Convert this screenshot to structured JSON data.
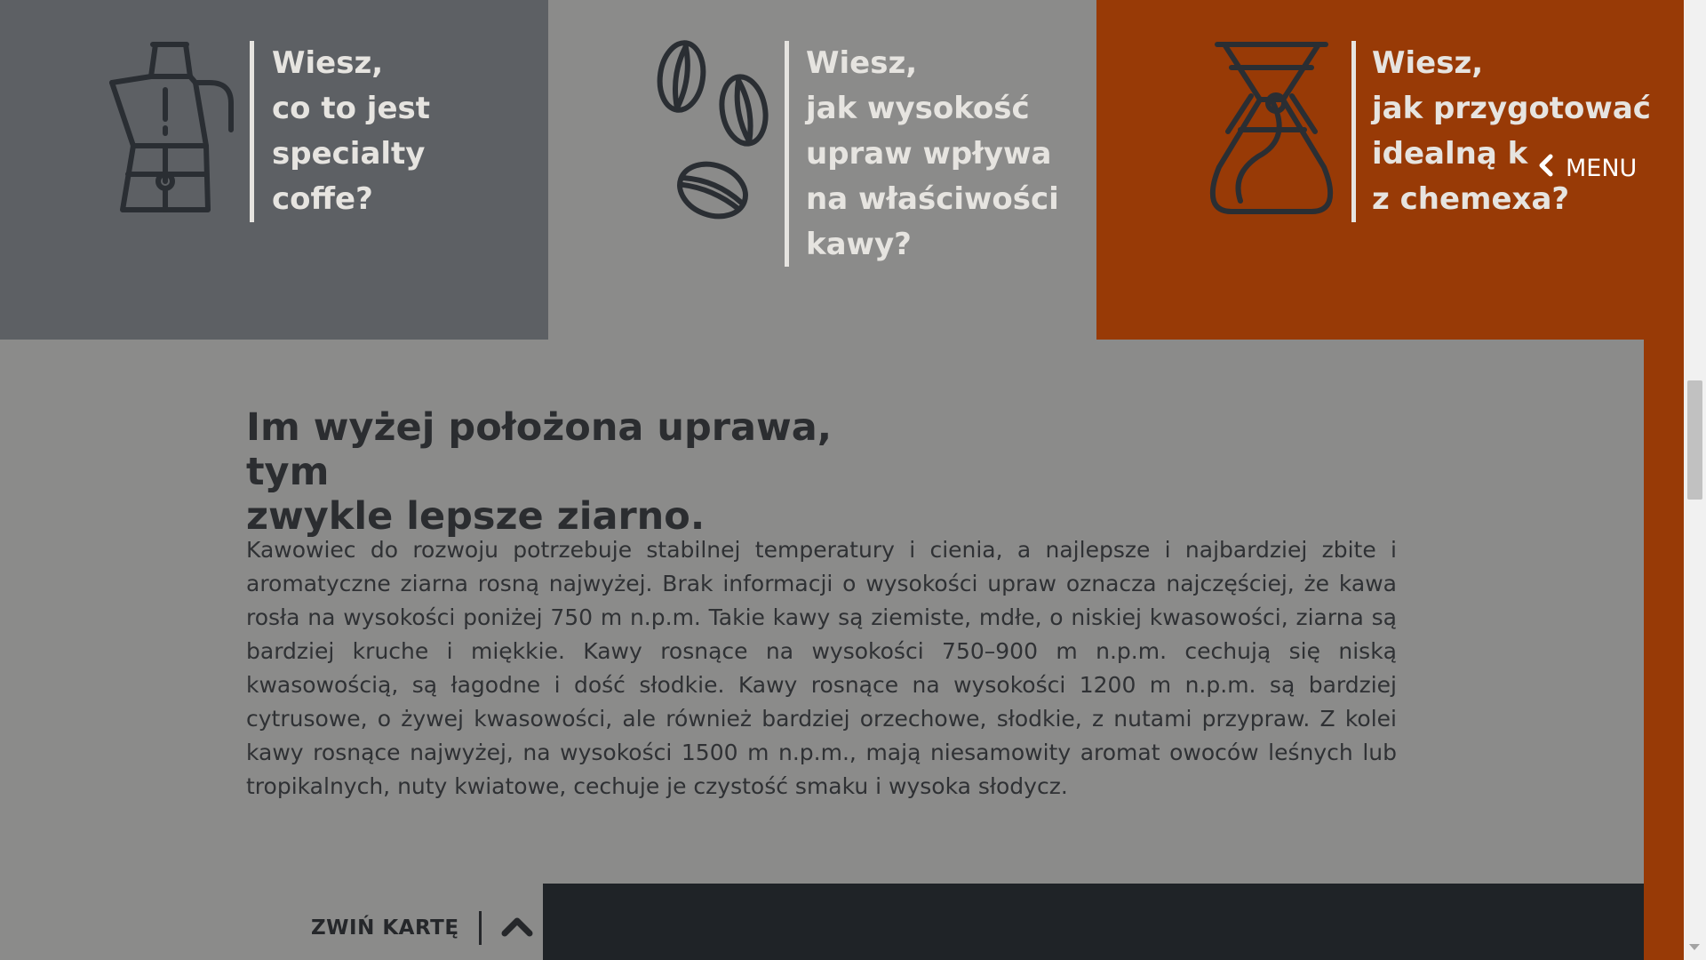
{
  "cards": [
    {
      "lines": [
        "Wiesz,",
        "co to jest",
        "specialty",
        "coffe?"
      ],
      "icon": "moka-pot-icon",
      "background": "#5d6064"
    },
    {
      "lines": [
        "Wiesz,",
        "jak wysokość",
        "upraw wpływa",
        "na właściwości",
        "kawy?"
      ],
      "icon": "coffee-beans-icon",
      "background": "#8b8b8a"
    },
    {
      "lines": [
        "Wiesz,",
        "jak przygotować",
        "idealną k",
        "z chemexa?"
      ],
      "icon": "chemex-icon",
      "background": "#983a06"
    }
  ],
  "menu": {
    "label": "MENU",
    "icon": "chevron-left-icon"
  },
  "article": {
    "title_line1": "Im wyżej położona uprawa, tym",
    "title_line2": "zwykle lepsze ziarno.",
    "body": "Kawowiec do rozwoju potrzebuje stabilnej temperatury i cienia, a najlepsze i najbardziej zbite i aromatyczne ziarna rosną najwyżej. Brak informacji o wysokości upraw oznacza najczęściej, że kawa rosła na wysokości poniżej 750 m n.p.m. Takie kawy są ziemiste, mdłe, o niskiej kwasowości, ziarna są bardziej kruche i miękkie. Kawy rosnące na wysokości 750–900 m n.p.m. cechują się niską kwasowością, są łagodne i dość słodkie. Kawy rosnące na wysokości 1200 m n.p.m. są bardziej cytrusowe, o żywej kwasowości, ale również bardziej orzechowe, słodkie, z nutami przypraw. Z kolei kawy rosnące najwyżej, na wysokości 1500 m n.p.m., mają niesamowity aromat owoców leśnych lub tropikalnych, nuty kwiatowe, cechuje je czystość smaku i wysoka słodycz."
  },
  "collapse": {
    "label": "ZWIŃ KARTĘ",
    "icon": "chevron-up-icon"
  },
  "colors": {
    "accent": "#983a06",
    "dark": "#1f2327",
    "light_text": "#e6e4e0"
  }
}
